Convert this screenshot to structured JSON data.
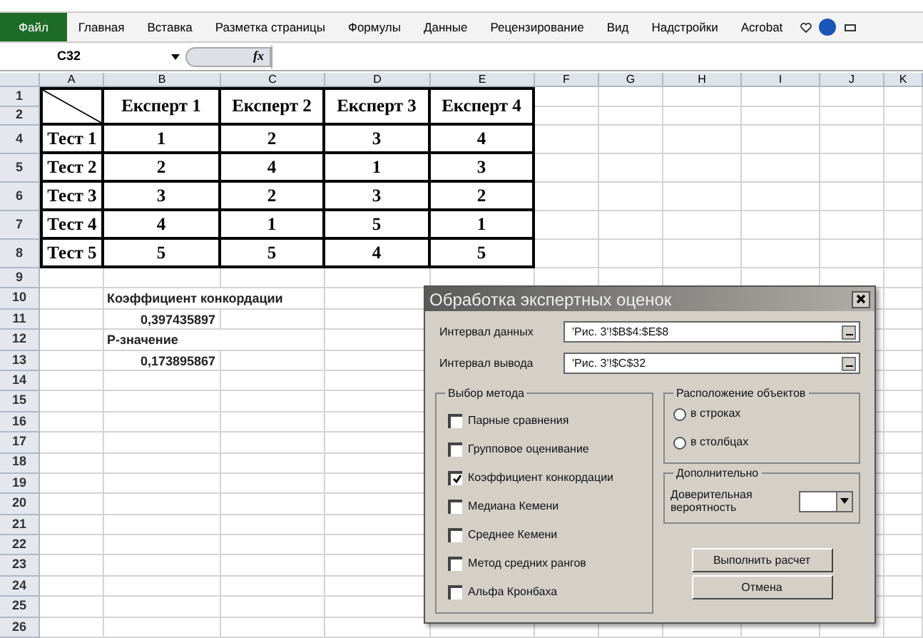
{
  "ribbon": {
    "file_tab": "Файл",
    "tabs": [
      "Главная",
      "Вставка",
      "Разметка страницы",
      "Формулы",
      "Данные",
      "Рецензирование",
      "Вид",
      "Надстройки",
      "Acrobat"
    ]
  },
  "formula_bar": {
    "name_box": "C32",
    "function_symbol": "fx"
  },
  "columns": [
    "A",
    "B",
    "C",
    "D",
    "E",
    "F",
    "G",
    "H",
    "I",
    "J",
    "K"
  ],
  "table": {
    "header_row_labels": [
      "1",
      "2"
    ],
    "headers": [
      "Експерт 1",
      "Експерт 2",
      "Експерт 3",
      "Експерт 4"
    ],
    "rows": [
      {
        "row_label": "4",
        "name": "Тест 1",
        "values": [
          "1",
          "2",
          "3",
          "4"
        ]
      },
      {
        "row_label": "5",
        "name": "Тест 2",
        "values": [
          "2",
          "4",
          "1",
          "3"
        ]
      },
      {
        "row_label": "6",
        "name": "Тест 3",
        "values": [
          "3",
          "2",
          "3",
          "2"
        ]
      },
      {
        "row_label": "7",
        "name": "Тест 4",
        "values": [
          "4",
          "1",
          "5",
          "1"
        ]
      },
      {
        "row_label": "8",
        "name": "Тест 5",
        "values": [
          "5",
          "5",
          "4",
          "5"
        ]
      }
    ]
  },
  "sheet_rows": [
    {
      "label": "9"
    },
    {
      "label": "10",
      "text": "Коэффициент конкордации",
      "kind": "label"
    },
    {
      "label": "11",
      "text": "0,397435897",
      "kind": "number"
    },
    {
      "label": "12",
      "text": "Р-значение",
      "kind": "label"
    },
    {
      "label": "13",
      "text": "0,173895867",
      "kind": "number"
    },
    {
      "label": "14"
    },
    {
      "label": "15"
    },
    {
      "label": "16"
    },
    {
      "label": "17"
    },
    {
      "label": "18"
    },
    {
      "label": "19"
    },
    {
      "label": "20"
    },
    {
      "label": "21"
    },
    {
      "label": "22"
    },
    {
      "label": "23"
    },
    {
      "label": "24"
    },
    {
      "label": "25"
    },
    {
      "label": "26"
    }
  ],
  "dialog": {
    "title": "Обработка экспертных оценок",
    "fields": [
      {
        "label": "Интервал данных",
        "value": "'Рис. 3'!$B$4:$E$8"
      },
      {
        "label": "Интервал вывода",
        "value": "'Рис. 3'!$C$32"
      }
    ],
    "method_group": {
      "title": "Выбор метода",
      "options": [
        {
          "label": "Парные сравнения",
          "checked": false
        },
        {
          "label": "Групповое оценивание",
          "checked": false
        },
        {
          "label": "Коэффициент конкордации",
          "checked": true
        },
        {
          "label": "Медиана Кемени",
          "checked": false
        },
        {
          "label": "Среднее Кемени",
          "checked": false
        },
        {
          "label": "Метод средних рангов",
          "checked": false
        },
        {
          "label": "Альфа Кронбаха",
          "checked": false
        }
      ]
    },
    "layout_group": {
      "title": "Расположение объектов",
      "options": [
        {
          "label": "в строках",
          "selected": false
        },
        {
          "label": "в столбцах",
          "selected": false
        }
      ]
    },
    "extra_group": {
      "title": "Дополнительно",
      "label": "Доверительная вероятность"
    },
    "buttons": [
      "Выполнить расчет",
      "Отмена"
    ]
  }
}
